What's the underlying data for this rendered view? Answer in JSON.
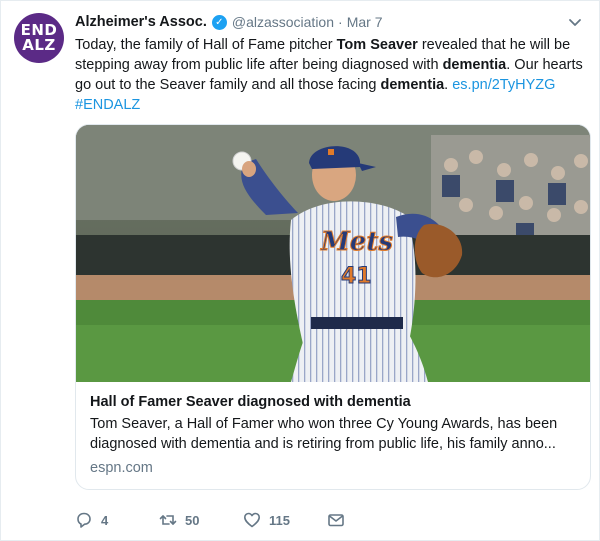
{
  "tweet": {
    "avatar": {
      "line1": "END",
      "line2": "ALZ",
      "color": "#5b2a86",
      "icon": "end-alz-logo"
    },
    "author_name": "Alzheimer's Assoc.",
    "verified_icon": "verified-badge-icon",
    "handle": "@alzassociation",
    "separator": "·",
    "time": "Mar 7",
    "text": {
      "part1": "Today, the family of Hall of Fame pitcher ",
      "bold1": "Tom Seaver",
      "part2": " revealed that he will be stepping away from public life after being diagnosed with ",
      "bold2": "dementia",
      "part3": ". Our hearts go out to the Seaver family and all those facing ",
      "bold3": "dementia",
      "part4": ". ",
      "link": "es.pn/2TyHYZG",
      "hashtag": "#ENDALZ"
    },
    "card": {
      "image": {
        "jersey_script": "Mets",
        "jersey_number": "41"
      },
      "title": "Hall of Famer Seaver diagnosed with dementia",
      "description": "Tom Seaver, a Hall of Famer who won three Cy Young Awards, has been diagnosed with dementia and is retiring from public life, his family anno...",
      "domain": "espn.com"
    },
    "actions": {
      "reply": {
        "icon": "reply-icon",
        "count": "4"
      },
      "retweet": {
        "icon": "retweet-icon",
        "count": "50"
      },
      "like": {
        "icon": "heart-icon",
        "count": "115"
      },
      "message": {
        "icon": "envelope-icon"
      }
    }
  },
  "colors": {
    "link": "#1b95e0",
    "muted": "#657786",
    "verified": "#1da1f2"
  }
}
